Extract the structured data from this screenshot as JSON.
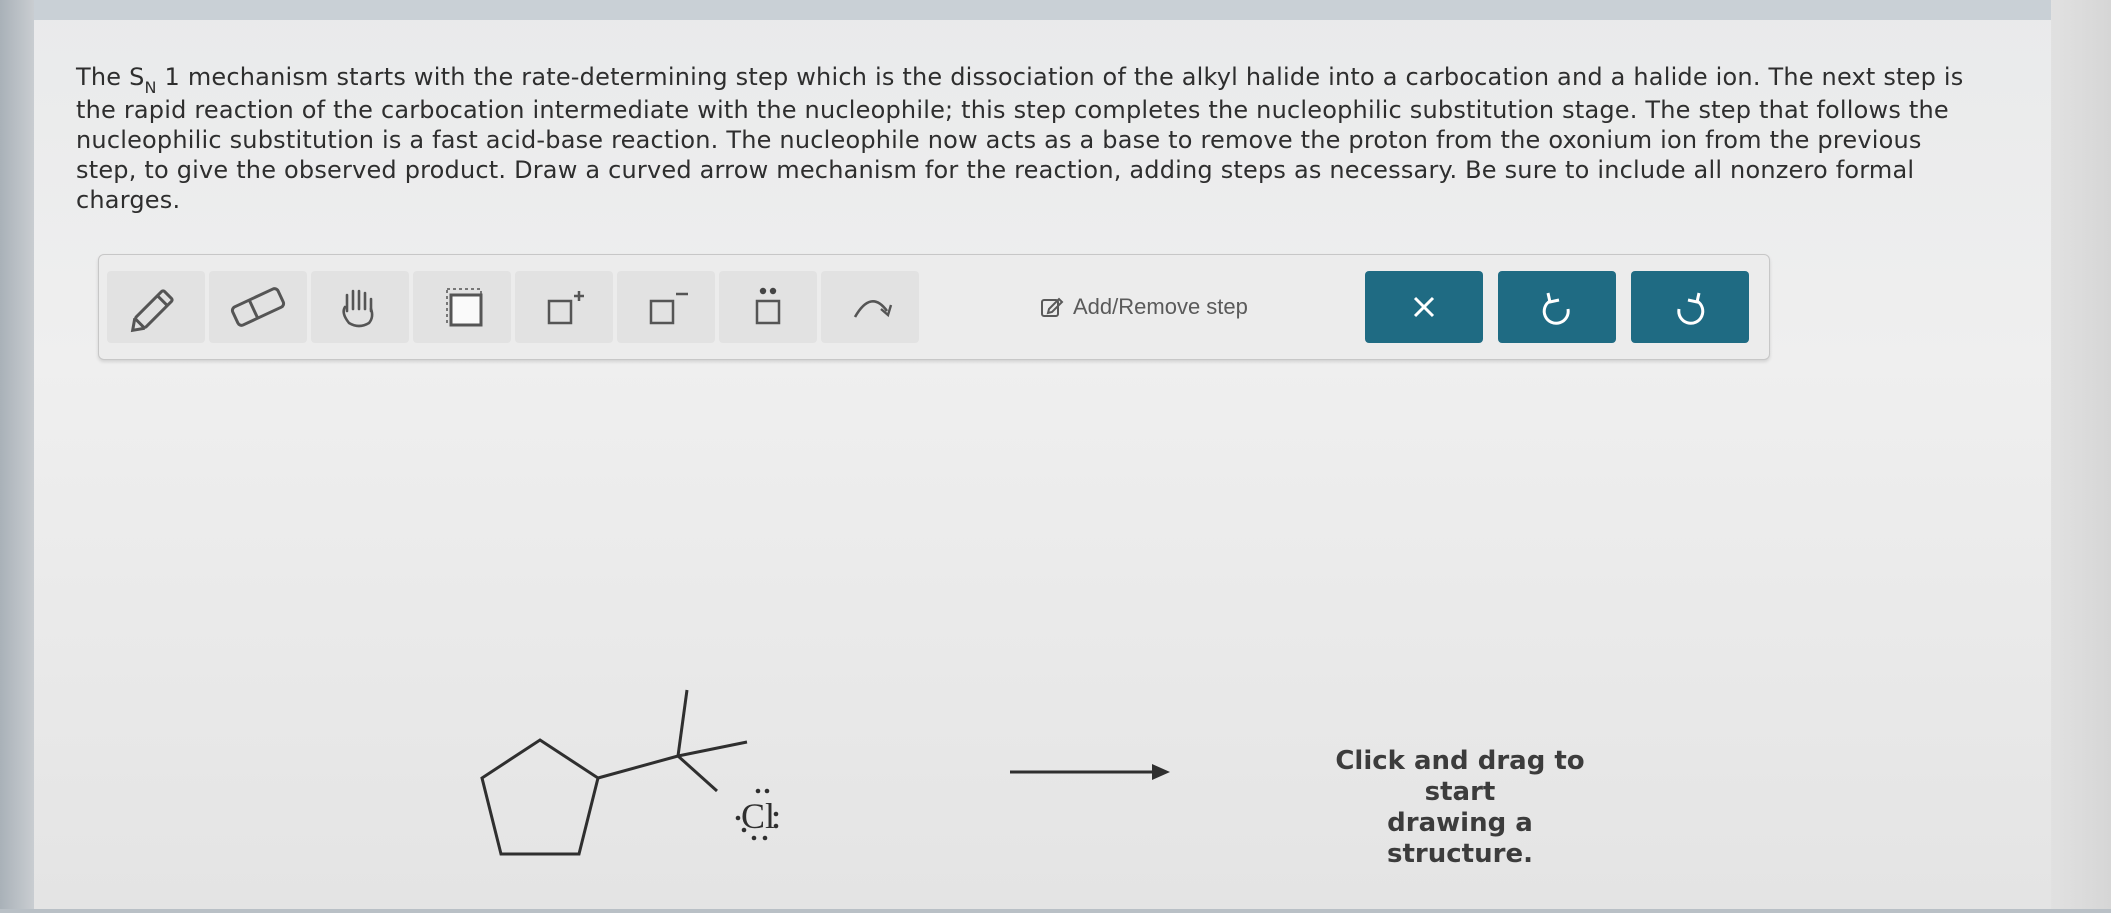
{
  "question": {
    "line1_pre": "The S",
    "line1_sub": "N",
    "line1_post": "1 mechanism starts with the rate-determining step which is the dissociation of the alkyl halide into a carbocation and a halide ion. The next step is",
    "line2": "the rapid reaction of the carbocation intermediate with the nucleophile; this step completes the nucleophilic substitution stage. The step that follows the",
    "line3": "nucleophilic substitution is a fast acid-base reaction. The nucleophile now acts as a base to remove the proton from the oxonium ion from the previous",
    "line4": "step, to give the observed product. Draw a curved arrow mechanism for the reaction, adding steps as necessary. Be sure to include all nonzero formal",
    "line5": "charges."
  },
  "toolbar": {
    "tools": [
      {
        "name": "pencil-icon"
      },
      {
        "name": "eraser-icon"
      },
      {
        "name": "hand-icon"
      },
      {
        "name": "select-box-icon"
      },
      {
        "name": "positive-charge-icon",
        "sign": "+"
      },
      {
        "name": "negative-charge-icon",
        "sign": "−"
      },
      {
        "name": "lone-pair-icon"
      },
      {
        "name": "curved-arrow-icon"
      }
    ],
    "add_remove_label": "Add/Remove step",
    "buttons": [
      {
        "name": "clear-button",
        "icon": "close-icon"
      },
      {
        "name": "undo-button",
        "icon": "undo-icon"
      },
      {
        "name": "redo-button",
        "icon": "redo-icon"
      }
    ],
    "accent": "#1f6b83"
  },
  "reaction": {
    "leaving_group_label": "Cl",
    "hint_line1": "Click and drag to start",
    "hint_line2": "drawing a structure."
  }
}
